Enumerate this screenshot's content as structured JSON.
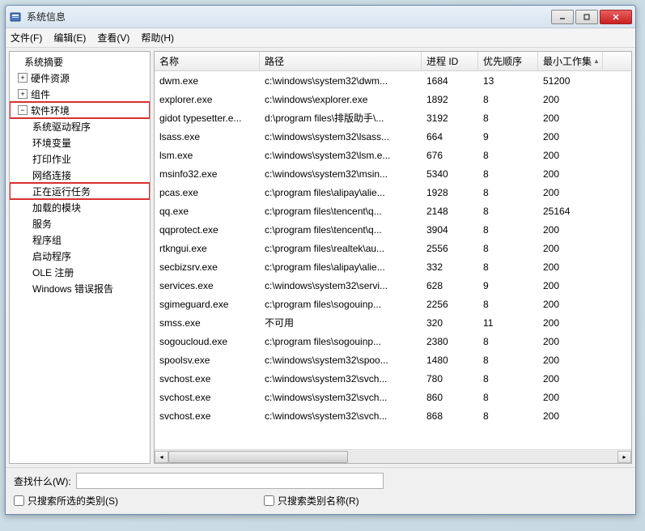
{
  "titlebar": {
    "title": "系统信息"
  },
  "menubar": {
    "file": "文件(F)",
    "edit": "编辑(E)",
    "view": "查看(V)",
    "help": "帮助(H)"
  },
  "tree": {
    "root": "系统摘要",
    "hardware": "硬件资源",
    "components": "组件",
    "software_env": "软件环境",
    "children": {
      "sys_drivers": "系统驱动程序",
      "env_vars": "环境变量",
      "print_jobs": "打印作业",
      "net_conn": "网络连接",
      "running_tasks": "正在运行任务",
      "loaded_modules": "加载的模块",
      "services": "服务",
      "program_groups": "程序组",
      "startup": "启动程序",
      "ole": "OLE 注册",
      "win_err": "Windows 错误报告"
    }
  },
  "columns": {
    "name": "名称",
    "path": "路径",
    "pid": "进程 ID",
    "priority": "优先顺序",
    "minws": "最小工作集"
  },
  "rows": [
    {
      "name": "dwm.exe",
      "path": "c:\\windows\\system32\\dwm...",
      "pid": "1684",
      "prio": "13",
      "minws": "51200"
    },
    {
      "name": "explorer.exe",
      "path": "c:\\windows\\explorer.exe",
      "pid": "1892",
      "prio": "8",
      "minws": "200"
    },
    {
      "name": "gidot typesetter.e...",
      "path": "d:\\program files\\排版助手\\...",
      "pid": "3192",
      "prio": "8",
      "minws": "200"
    },
    {
      "name": "lsass.exe",
      "path": "c:\\windows\\system32\\lsass...",
      "pid": "664",
      "prio": "9",
      "minws": "200"
    },
    {
      "name": "lsm.exe",
      "path": "c:\\windows\\system32\\lsm.e...",
      "pid": "676",
      "prio": "8",
      "minws": "200"
    },
    {
      "name": "msinfo32.exe",
      "path": "c:\\windows\\system32\\msin...",
      "pid": "5340",
      "prio": "8",
      "minws": "200"
    },
    {
      "name": "pcas.exe",
      "path": "c:\\program files\\alipay\\alie...",
      "pid": "1928",
      "prio": "8",
      "minws": "200"
    },
    {
      "name": "qq.exe",
      "path": "c:\\program files\\tencent\\q...",
      "pid": "2148",
      "prio": "8",
      "minws": "25164"
    },
    {
      "name": "qqprotect.exe",
      "path": "c:\\program files\\tencent\\q...",
      "pid": "3904",
      "prio": "8",
      "minws": "200"
    },
    {
      "name": "rtkngui.exe",
      "path": "c:\\program files\\realtek\\au...",
      "pid": "2556",
      "prio": "8",
      "minws": "200"
    },
    {
      "name": "secbizsrv.exe",
      "path": "c:\\program files\\alipay\\alie...",
      "pid": "332",
      "prio": "8",
      "minws": "200"
    },
    {
      "name": "services.exe",
      "path": "c:\\windows\\system32\\servi...",
      "pid": "628",
      "prio": "9",
      "minws": "200"
    },
    {
      "name": "sgimeguard.exe",
      "path": "c:\\program files\\sogouinp...",
      "pid": "2256",
      "prio": "8",
      "minws": "200"
    },
    {
      "name": "smss.exe",
      "path": "不可用",
      "pid": "320",
      "prio": "11",
      "minws": "200"
    },
    {
      "name": "sogoucloud.exe",
      "path": "c:\\program files\\sogouinp...",
      "pid": "2380",
      "prio": "8",
      "minws": "200"
    },
    {
      "name": "spoolsv.exe",
      "path": "c:\\windows\\system32\\spoo...",
      "pid": "1480",
      "prio": "8",
      "minws": "200"
    },
    {
      "name": "svchost.exe",
      "path": "c:\\windows\\system32\\svch...",
      "pid": "780",
      "prio": "8",
      "minws": "200"
    },
    {
      "name": "svchost.exe",
      "path": "c:\\windows\\system32\\svch...",
      "pid": "860",
      "prio": "8",
      "minws": "200"
    },
    {
      "name": "svchost.exe",
      "path": "c:\\windows\\system32\\svch...",
      "pid": "868",
      "prio": "8",
      "minws": "200"
    }
  ],
  "footer": {
    "search_label": "查找什么(W):",
    "only_selected": "只搜索所选的类别(S)",
    "only_names": "只搜索类别名称(R)"
  }
}
